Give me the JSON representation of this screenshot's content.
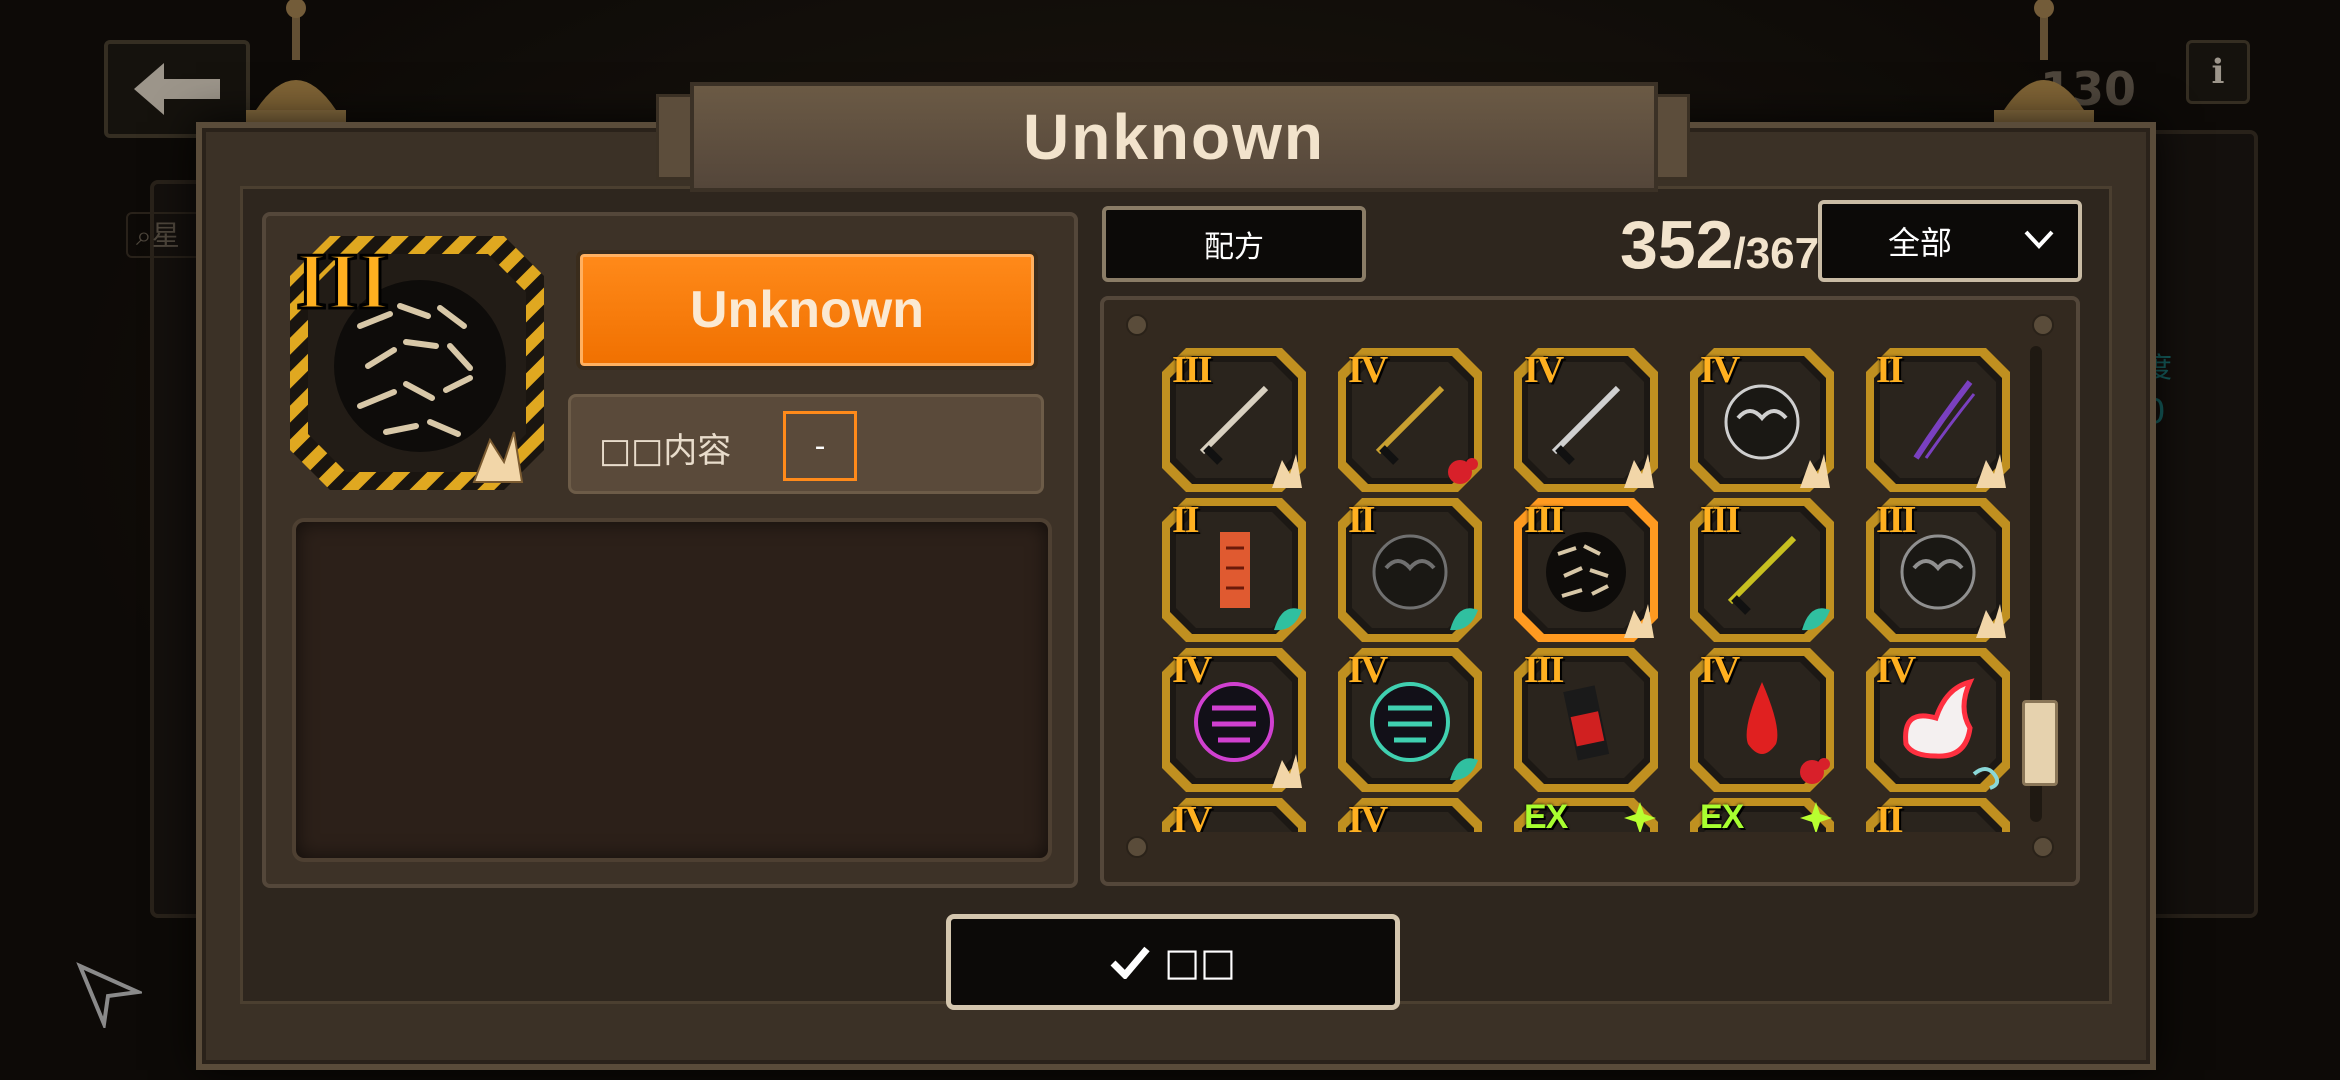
{
  "dialog": {
    "title": "Unknown"
  },
  "item": {
    "name": "Unknown",
    "tier": "III",
    "content_label": "□□内容",
    "content_value": "-",
    "description": ""
  },
  "catalog": {
    "recipe_label": "配方",
    "owned_count": "352",
    "total_count": "/367",
    "filter_label": "全部",
    "cells": [
      {
        "tier": "III",
        "art": "katana-guard",
        "accent": "#d8d0c0",
        "badge": "flame",
        "selected": false
      },
      {
        "tier": "IV",
        "art": "golden-katana",
        "accent": "#c9a030",
        "badge": "red-splash",
        "selected": false
      },
      {
        "tier": "IV",
        "art": "katana",
        "accent": "#d0d0d0",
        "badge": "flame",
        "selected": false
      },
      {
        "tier": "IV",
        "art": "cloud-emblem",
        "accent": "#cfcfcf",
        "badge": "flame",
        "selected": false
      },
      {
        "tier": "II",
        "art": "purple-slash",
        "accent": "#7a40c0",
        "badge": "flame",
        "selected": false
      },
      {
        "tier": "II",
        "art": "talisman",
        "accent": "#e05a30",
        "badge": "teal-leaf",
        "selected": false
      },
      {
        "tier": "II",
        "art": "beast-head",
        "accent": "#707070",
        "badge": "teal-leaf",
        "selected": false
      },
      {
        "tier": "III",
        "art": "chains",
        "accent": "#d8c8a8",
        "badge": "flame",
        "selected": true
      },
      {
        "tier": "III",
        "art": "black-scabbard",
        "accent": "#c8c020",
        "badge": "teal-leaf",
        "selected": false
      },
      {
        "tier": "III",
        "art": "feather-fan",
        "accent": "#909090",
        "badge": "flame",
        "selected": false
      },
      {
        "tier": "IV",
        "art": "magenta-sigil",
        "accent": "#d040d0",
        "badge": "flame",
        "selected": false
      },
      {
        "tier": "IV",
        "art": "neon-seal",
        "accent": "#40d0b0",
        "badge": "teal-leaf",
        "selected": false
      },
      {
        "tier": "III",
        "art": "red-bottle",
        "accent": "#d02020",
        "badge": "none",
        "selected": false
      },
      {
        "tier": "IV",
        "art": "blood-drop",
        "accent": "#e02020",
        "badge": "red-splash",
        "selected": false
      },
      {
        "tier": "IV",
        "art": "white-flame",
        "accent": "#ff3040",
        "badge": "wind",
        "selected": false
      },
      {
        "tier": "IV",
        "art": "sword",
        "accent": "#d0d0d0",
        "badge": "none",
        "selected": false
      },
      {
        "tier": "IV",
        "art": "dark-blade",
        "accent": "#909090",
        "badge": "none",
        "selected": false
      },
      {
        "tier": "EX",
        "art": "unknown",
        "accent": "#a8ff30",
        "badge": "sparkle",
        "selected": false
      },
      {
        "tier": "EX",
        "art": "unknown",
        "accent": "#a8ff30",
        "badge": "sparkle",
        "selected": false
      },
      {
        "tier": "II",
        "art": "unknown",
        "accent": "#60a080",
        "badge": "none",
        "selected": false
      }
    ]
  },
  "confirm_label": "□□",
  "colors": {
    "accent_orange": "#f07000",
    "tier_gold": "#ffb020",
    "tier_ex": "#a8ff30"
  },
  "background": {
    "counter_text": "130",
    "search_hint": "星",
    "side_text_1": "度",
    "side_text_2": "0"
  }
}
